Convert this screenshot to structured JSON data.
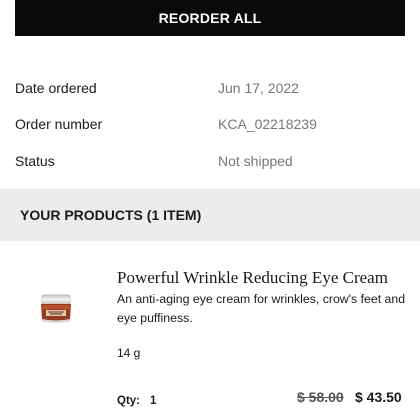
{
  "reorder": {
    "label": "REORDER ALL"
  },
  "order_info": {
    "date_label": "Date ordered",
    "date_value": "Jun 17, 2022",
    "number_label": "Order number",
    "number_value": "KCA_02218239",
    "status_label": "Status",
    "status_value": "Not shipped"
  },
  "products_header": "YOUR PRODUCTS (1 ITEM)",
  "product": {
    "image_icon": "eye-cream-jar",
    "name": "Powerful Wrinkle Reducing Eye Cream",
    "description": "An anti-aging eye cream for wrinkles, crow's feet and eye puffiness.",
    "size": "14 g",
    "qty_label": "Qty:",
    "qty_value": "1",
    "price_original": "$ 58.00",
    "price_sale": "$ 43.50"
  },
  "colors": {
    "button_bg": "#0a0a0a",
    "header_bg": "#ececec",
    "muted_text": "#777777"
  }
}
